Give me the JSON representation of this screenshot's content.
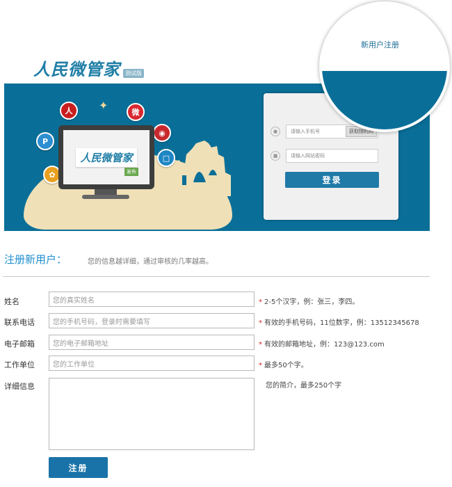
{
  "header": {
    "logo_text": "人民微管家",
    "logo_badge": "测试版",
    "new_user_link": "新用户注册"
  },
  "banner": {
    "monitor_logo": "人民微管家",
    "monitor_tag": "发布",
    "login": {
      "phone_placeholder": "请输入手机号",
      "sms_button": "获取随机码",
      "password_placeholder": "请输入网站密码",
      "login_button": "登录"
    }
  },
  "register": {
    "title": "注册新用户：",
    "description": "您的信息越详细，通过审核的几率越高。",
    "fields": [
      {
        "label": "姓名",
        "placeholder": "您的真实姓名",
        "hint": "2-5个汉字，例：张三，李四。",
        "required": true
      },
      {
        "label": "联系电话",
        "placeholder": "您的手机号码，登录时需要填写",
        "hint": "有效的手机号码，11位数字，例：13512345678",
        "required": true
      },
      {
        "label": "电子邮箱",
        "placeholder": "您的电子邮箱地址",
        "hint": "有效的邮箱地址，例：123@123.com",
        "required": true
      },
      {
        "label": "工作单位",
        "placeholder": "您的工作单位",
        "hint": "最多50个字。",
        "required": true
      }
    ],
    "details": {
      "label": "详细信息",
      "hint": "您的简介，最多250个字"
    },
    "submit_label": "注册",
    "required_mark": "*"
  },
  "colors": {
    "banner_blue": "#0a6f98",
    "accent_blue": "#1f8fd0",
    "required_red": "#d31c1c"
  }
}
